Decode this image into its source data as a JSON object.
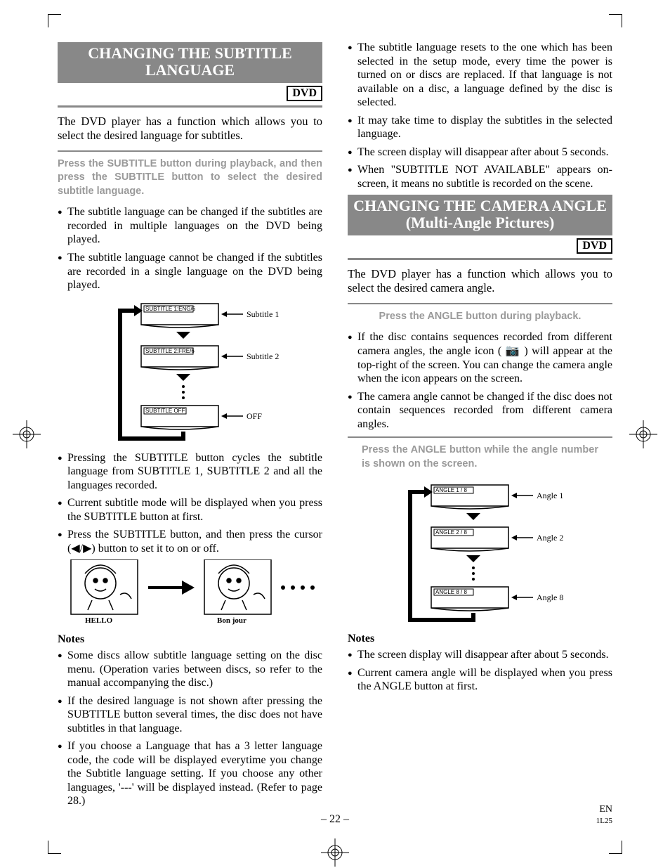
{
  "left": {
    "heading": "CHANGING THE SUBTITLE LANGUAGE",
    "tag": "DVD",
    "intro": "The DVD player has a function which allows you to select the desired language for subtitles.",
    "instruction": "Press the SUBTITLE button during playback, and then press the SUBTITLE button to select the desired subtitle language.",
    "points_a": [
      "The subtitle language can be changed if the subtitles are recorded in multiple languages on the DVD being played.",
      "The subtitle language cannot be changed if the subtitles are recorded in a single language on the DVD being played."
    ],
    "diagram": {
      "rows": [
        {
          "osd": "SUBTITLE 1:ENG/6",
          "label": "Subtitle 1"
        },
        {
          "osd": "SUBTITLE 2:FRE/6",
          "label": "Subtitle 2"
        },
        {
          "osd": "SUBTITLE OFF",
          "label": "OFF"
        }
      ]
    },
    "points_b": [
      "Pressing the SUBTITLE button cycles the subtitle language from SUBTITLE 1, SUBTITLE 2 and all the languages recorded.",
      "Current subtitle mode will be displayed when you press the SUBTITLE button at first.",
      "Press the SUBTITLE button, and then press the cursor (◀/▶) button to set it to on or off."
    ],
    "illus": {
      "caption1": "HELLO",
      "caption2": "Bon jour"
    },
    "notes_h": "Notes",
    "notes": [
      "Some discs allow subtitle language setting on the disc menu. (Operation varies between discs, so refer to the manual accompanying the disc.)",
      "If the desired language is not shown after pressing the SUBTITLE button several times, the disc does not have subtitles in that language.",
      "If you choose a Language that has a 3 letter language code, the code will be displayed everytime you change the Subtitle language setting. If you choose any other languages, '---' will be displayed instead. (Refer to page 28.)"
    ]
  },
  "right": {
    "cont_bullets": [
      "The subtitle language resets to the one which has been selected in the setup mode, every time the power is turned on or discs are replaced. If that language is not available on a disc, a language defined by the disc is selected.",
      "It may take time to display the subtitles in the selected language.",
      "The screen display will disappear after about 5 seconds.",
      "When \"SUBTITLE NOT AVAILABLE\" appears on-screen, it means no subtitle is recorded on the scene."
    ],
    "heading": "CHANGING THE CAMERA ANGLE (Multi-Angle Pictures)",
    "tag": "DVD",
    "intro": "The DVD player has a function which allows you to select the desired camera angle.",
    "instr1": "Press the ANGLE button during playback.",
    "points_a": [
      "If the disc contains sequences recorded from different camera angles, the angle icon ( 📷 ) will appear at the top-right of the screen. You can change the camera angle when the icon appears on the screen.",
      "The camera angle cannot be changed if the disc does not contain sequences recorded from different camera angles."
    ],
    "instr2": "Press the ANGLE button while the angle number is shown on the screen.",
    "diagram": {
      "rows": [
        {
          "osd": "ANGLE  1 / 8",
          "label": "Angle 1"
        },
        {
          "osd": "ANGLE  2 / 8",
          "label": "Angle 2"
        },
        {
          "osd": "ANGLE  8 / 8",
          "label": "Angle 8"
        }
      ]
    },
    "notes_h": "Notes",
    "notes": [
      "The screen display will disappear after about 5 seconds.",
      "Current camera angle will be displayed when you press the ANGLE button at first."
    ]
  },
  "footer": {
    "page": "– 22 –",
    "lang": "EN",
    "code": "1L25"
  }
}
